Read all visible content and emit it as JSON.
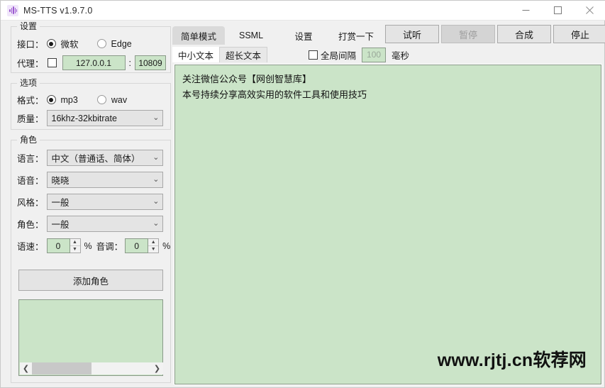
{
  "window": {
    "title": "MS-TTS v1.9.7.0",
    "icon": "waveform-icon",
    "minimize": "–",
    "maximize": "□",
    "close": "✕"
  },
  "colors": {
    "field_green": "#cbe4c8",
    "field_green_border": "#8a9a89",
    "window_bg": "#f0f0f0",
    "control_bg": "#e4e4e4",
    "active_tab_bg": "#dadada",
    "icon_purple": "#9b59d0"
  },
  "settings_group": {
    "title": "设置",
    "interface_label": "接口：",
    "interface_options": [
      {
        "label": "微软",
        "selected": true
      },
      {
        "label": "Edge",
        "selected": false
      }
    ],
    "proxy_label": "代理：",
    "proxy_checked": false,
    "proxy_host": "127.0.0.1",
    "proxy_separator": ":",
    "proxy_port": "10809"
  },
  "options_group": {
    "title": "选项",
    "format_label": "格式：",
    "format_options": [
      {
        "label": "mp3",
        "selected": true
      },
      {
        "label": "wav",
        "selected": false
      }
    ],
    "quality_label": "质量：",
    "quality_value": "16khz-32kbitrate"
  },
  "role_group": {
    "title": "角色",
    "language_label": "语言：",
    "language_value": "中文（普通话、简体）",
    "voice_label": "语音：",
    "voice_value": "晓晓",
    "style_label": "风格：",
    "style_value": "一般",
    "role_label": "角色：",
    "role_value": "一般",
    "rate_label": "语速：",
    "rate_value": "0",
    "rate_unit": "%",
    "pitch_label": "音调：",
    "pitch_value": "0",
    "pitch_unit": "%",
    "add_role_button": "添加角色",
    "spinner_up": "▲",
    "spinner_down": "▼",
    "scroll_left": "❮",
    "scroll_right": "❯"
  },
  "tabs": [
    {
      "label": "简单模式",
      "active": true
    },
    {
      "label": "SSML",
      "active": false
    },
    {
      "label": "设置",
      "active": false
    },
    {
      "label": "打赏一下",
      "active": false
    }
  ],
  "action_buttons": [
    {
      "label": "试听",
      "disabled": false
    },
    {
      "label": "暂停",
      "disabled": true
    },
    {
      "label": "合成",
      "disabled": false
    },
    {
      "label": "停止",
      "disabled": false
    }
  ],
  "subtabs": [
    {
      "label": "中小文本",
      "active": true
    },
    {
      "label": "超长文本",
      "active": false
    }
  ],
  "interval": {
    "checkbox_label": "全局间隔",
    "checked": false,
    "value": "100",
    "unit": "毫秒"
  },
  "editor": {
    "line1": "关注微信公众号【网创智慧库】",
    "line2": "本号持续分享高效实用的软件工具和使用技巧",
    "watermark": "www.rjtj.cn软荐网"
  },
  "chevron": "⌄"
}
